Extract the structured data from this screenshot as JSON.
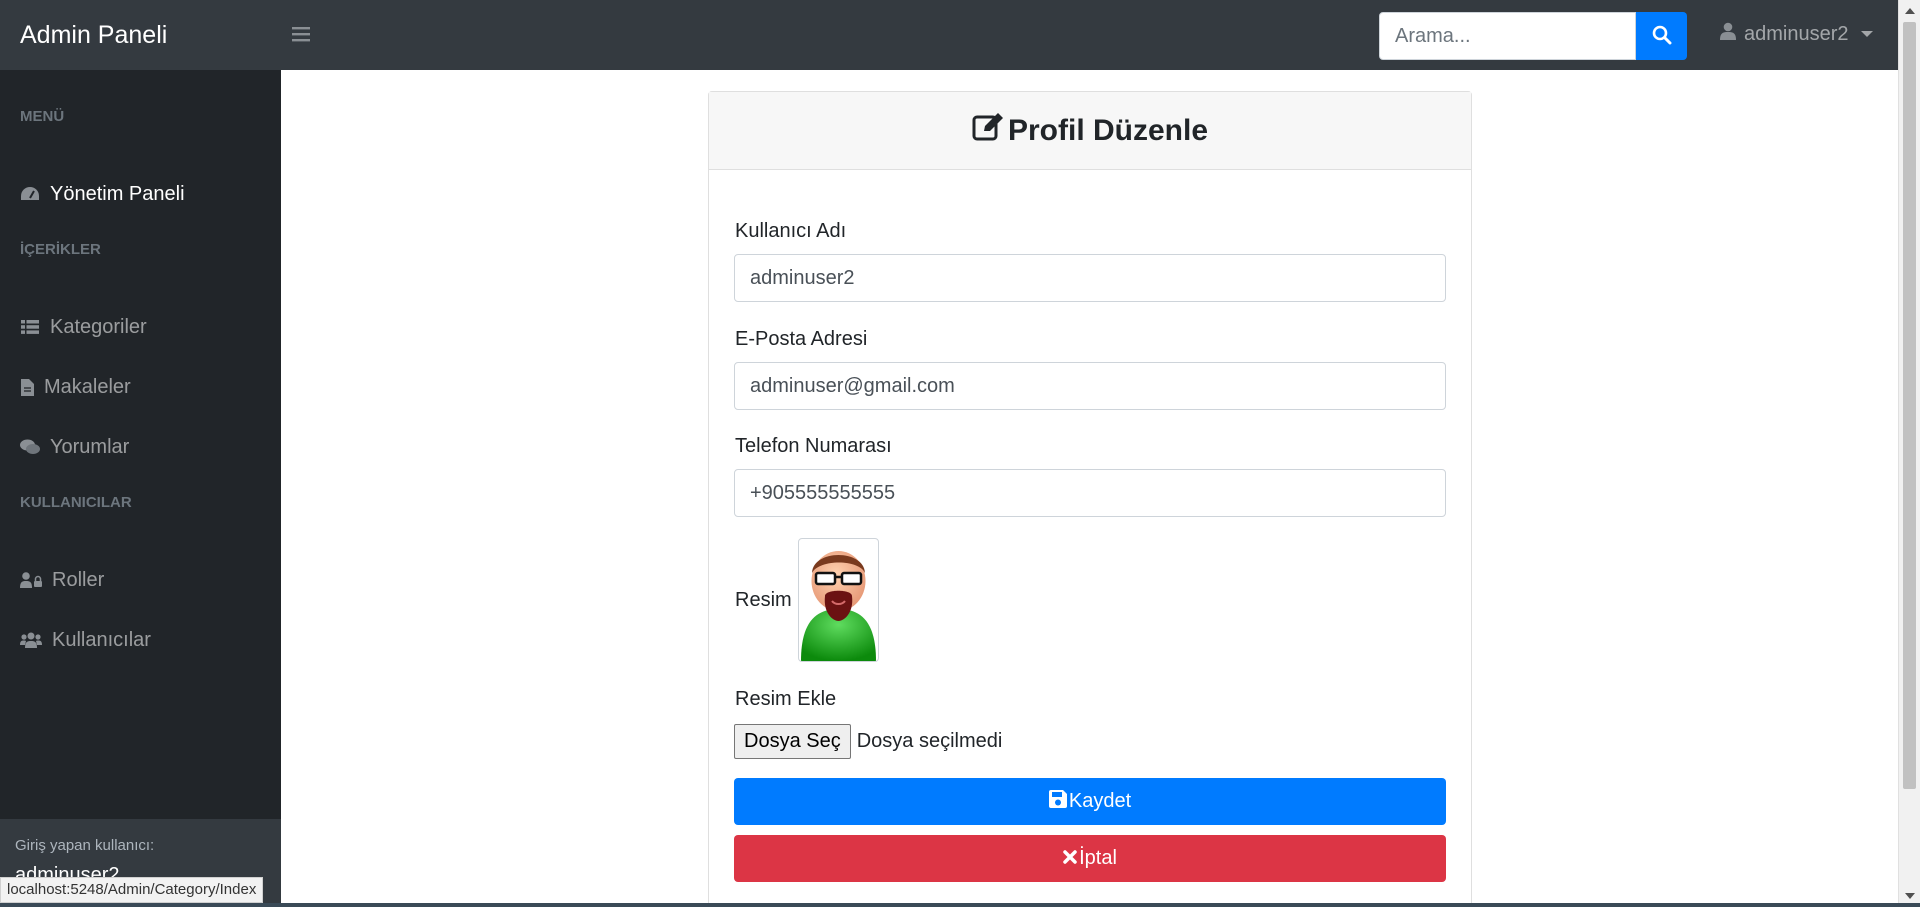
{
  "navbar": {
    "brand": "Admin Paneli",
    "search_placeholder": "Arama...",
    "user": "adminuser2"
  },
  "sidebar": {
    "sections": [
      {
        "heading": "MENÜ",
        "items": [
          {
            "label": "Yönetim Paneli",
            "icon": "dashboard-icon",
            "active": true
          }
        ]
      },
      {
        "heading": "İÇERİKLER",
        "items": [
          {
            "label": "Kategoriler",
            "icon": "table-list-icon"
          },
          {
            "label": "Makaleler",
            "icon": "file-icon"
          },
          {
            "label": "Yorumlar",
            "icon": "comments-icon"
          }
        ]
      },
      {
        "heading": "KULLANICILAR",
        "items": [
          {
            "label": "Roller",
            "icon": "user-lock-icon"
          },
          {
            "label": "Kullanıcılar",
            "icon": "users-icon"
          }
        ]
      }
    ],
    "footer": {
      "label": "Giriş yapan kullanıcı:",
      "user": "adminuser2"
    }
  },
  "status_url": "localhost:5248/Admin/Category/Index",
  "form": {
    "title": "Profil Düzenle",
    "username_label": "Kullanıcı Adı",
    "username_value": "adminuser2",
    "email_label": "E-Posta Adresi",
    "email_value": "adminuser@gmail.com",
    "phone_label": "Telefon Numarası",
    "phone_value": "+905555555555",
    "image_label": "Resim",
    "add_image_label": "Resim Ekle",
    "file_button": "Dosya Seç",
    "file_status": "Dosya seçilmedi",
    "save_button": "Kaydet",
    "cancel_button": "İptal"
  },
  "colors": {
    "navbar": "#343a40",
    "sidebar": "#212529",
    "primary": "#007bff",
    "danger": "#dc3545"
  }
}
